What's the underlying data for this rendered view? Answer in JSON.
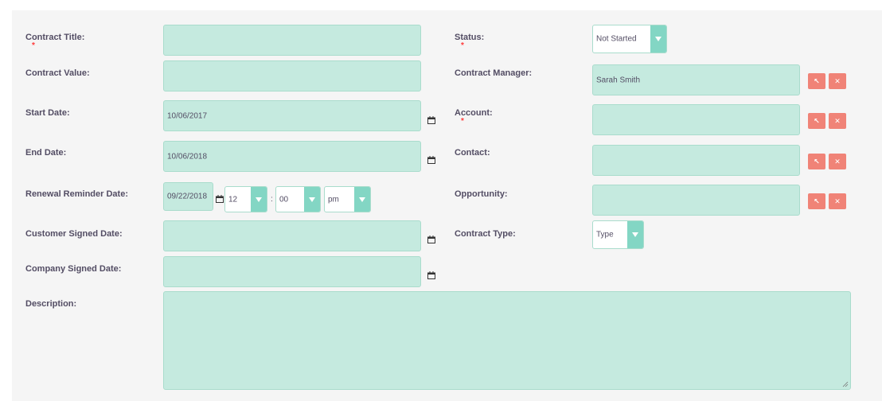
{
  "left_fields": {
    "contract_title": {
      "label": "Contract Title:",
      "required": "*",
      "value": ""
    },
    "contract_value": {
      "label": "Contract Value:",
      "value": ""
    },
    "start_date": {
      "label": "Start Date:",
      "value": "10/06/2017"
    },
    "end_date": {
      "label": "End Date:",
      "value": "10/06/2018"
    },
    "renewal_reminder_date": {
      "label": "Renewal Reminder Date:",
      "date": "09/22/2018",
      "hour": "12",
      "separator": ":",
      "minute": "00",
      "meridiem": "pm"
    },
    "customer_signed_date": {
      "label": "Customer Signed Date:",
      "value": ""
    },
    "company_signed_date": {
      "label": "Company Signed Date:",
      "value": ""
    },
    "description": {
      "label": "Description:",
      "value": ""
    }
  },
  "right_fields": {
    "status": {
      "label": "Status:",
      "required": "*",
      "value": "Not Started"
    },
    "contract_manager": {
      "label": "Contract Manager:",
      "value": "Sarah Smith"
    },
    "account": {
      "label": "Account:",
      "required": "*",
      "value": ""
    },
    "contact": {
      "label": "Contact:",
      "value": ""
    },
    "opportunity": {
      "label": "Opportunity:",
      "value": ""
    },
    "contract_type": {
      "label": "Contract Type:",
      "value": "Type"
    }
  },
  "buttons": {
    "select_symbol": "↖",
    "clear_symbol": "✕"
  },
  "icons": {
    "calendar": "calendar-icon",
    "select": "select-arrow-icon",
    "clear": "clear-x-icon"
  },
  "colors": {
    "field_bg": "#c5eadf",
    "field_border": "#a9dccc",
    "dropdown_arrow_bg": "#83d6c4",
    "button_bg": "#f08377",
    "label": "#534d64",
    "required": "#ff3a3a"
  }
}
